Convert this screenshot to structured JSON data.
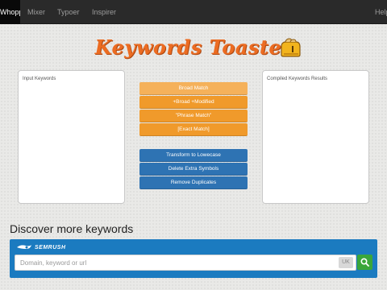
{
  "navbar": {
    "items": [
      {
        "label": "Whopper",
        "active": true
      },
      {
        "label": "Mixer"
      },
      {
        "label": "Typoer"
      },
      {
        "label": "Inspirer"
      }
    ],
    "help_label": "Help"
  },
  "header": {
    "title": "Keywords Toaster",
    "icon": "toaster-icon"
  },
  "input_panel": {
    "label": "Input Keywords"
  },
  "output_panel": {
    "label": "Compiled Keywords Results"
  },
  "match_buttons": [
    {
      "label": "Broad Match"
    },
    {
      "label": "+Broad +Modified"
    },
    {
      "label": "\"Phrase Match\""
    },
    {
      "label": "[Exact Match]"
    }
  ],
  "tool_buttons": [
    {
      "label": "Transform to Lowecase"
    },
    {
      "label": "Delete Extra Symbols"
    },
    {
      "label": "Remove Duplicates"
    }
  ],
  "discover": {
    "heading": "Discover more keywords",
    "brand": "SEMRUSH",
    "search_placeholder": "Domain, keyword or url",
    "country": "UK",
    "search_icon": "search-icon"
  },
  "colors": {
    "navbar": "#2a2a2a",
    "title": "#ec6c22",
    "match_button": "#f09a2b",
    "tool_button": "#2e73b3",
    "semrush_panel": "#1b7bc0",
    "search_button": "#3aa63a"
  }
}
